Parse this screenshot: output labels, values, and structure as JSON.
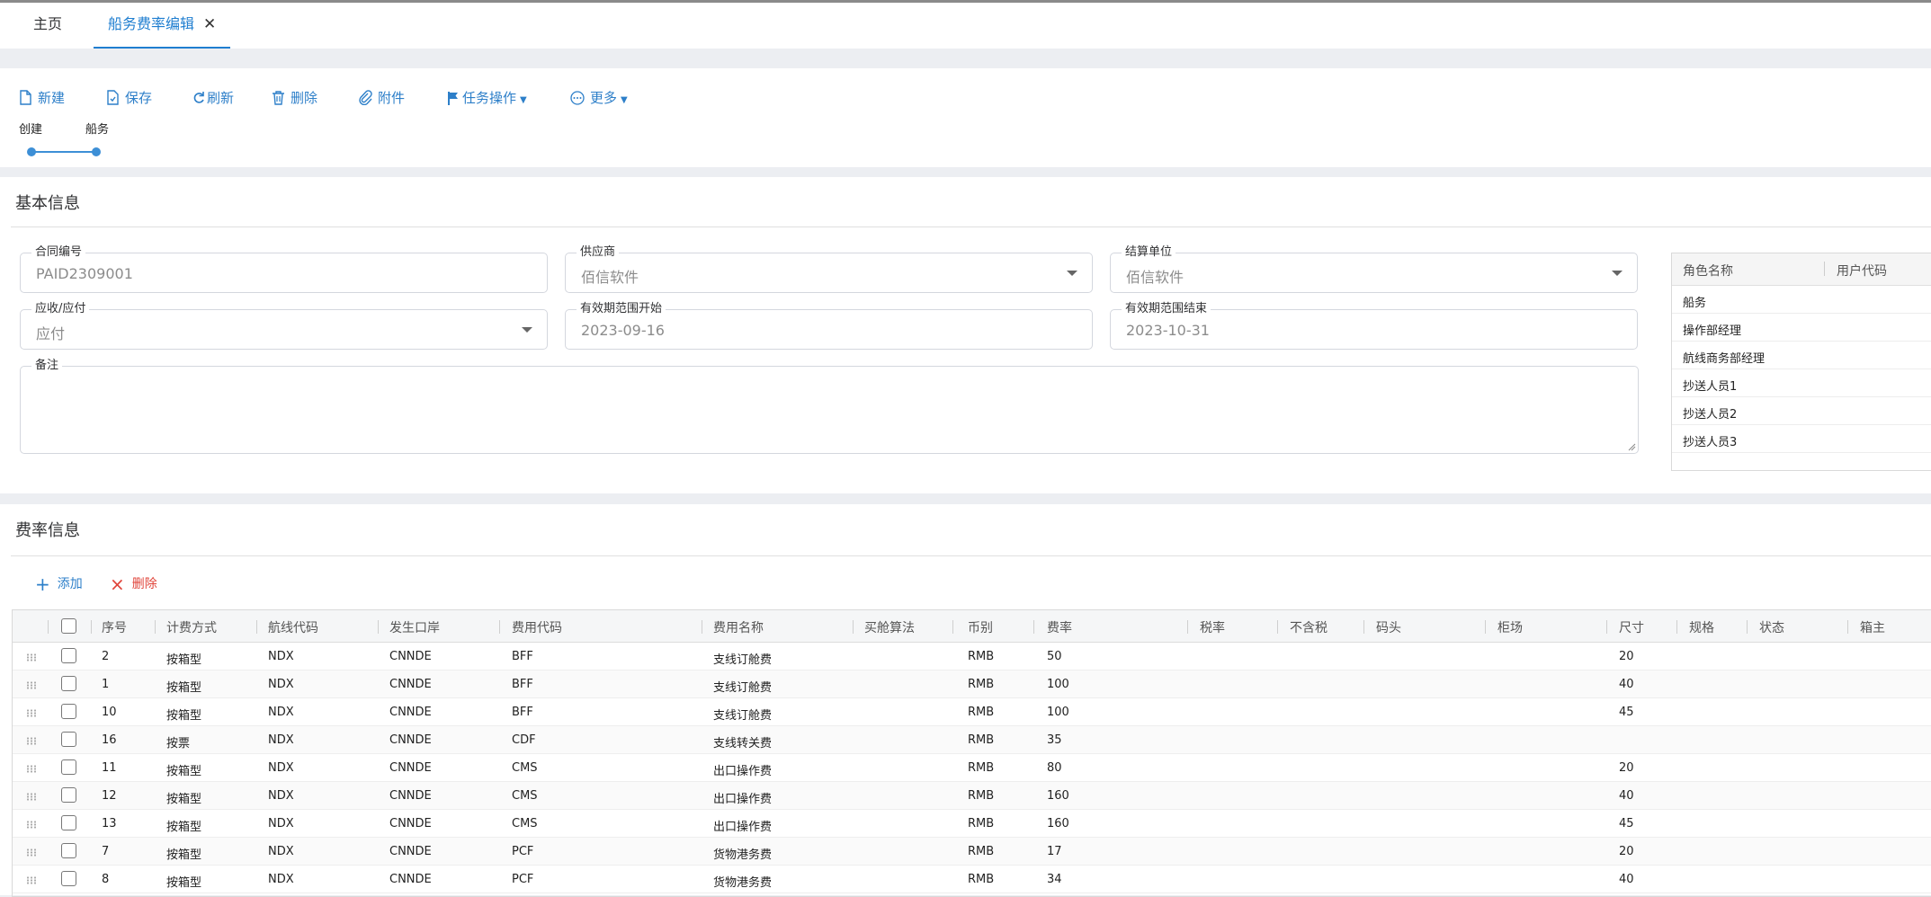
{
  "tabs": [
    {
      "label": "主页"
    },
    {
      "label": "船务费率编辑",
      "close": "✕"
    }
  ],
  "toolbar": {
    "new": "新建",
    "save": "保存",
    "refresh": "刷新",
    "delete": "删除",
    "attach": "附件",
    "task": "任务操作",
    "more": "更多"
  },
  "steps": [
    "创建",
    "船务"
  ],
  "base": {
    "title": "基本信息",
    "contract_no": {
      "label": "合同编号",
      "value": "PAID2309001"
    },
    "supplier": {
      "label": "供应商",
      "value": "佰信软件"
    },
    "settlement": {
      "label": "结算单位",
      "value": "佰信软件"
    },
    "recv_pay": {
      "label": "应收/应付",
      "value": "应付"
    },
    "valid_start": {
      "label": "有效期范围开始",
      "value": "2023-09-16"
    },
    "valid_end": {
      "label": "有效期范围结束",
      "value": "2023-10-31"
    },
    "remark": {
      "label": "备注",
      "value": ""
    }
  },
  "role_grid": {
    "headers": [
      "角色名称",
      "用户代码"
    ],
    "rows": [
      "船务",
      "操作部经理",
      "航线商务部经理",
      "抄送人员1",
      "抄送人员2",
      "抄送人员3"
    ]
  },
  "fee": {
    "title": "费率信息",
    "add": "添加",
    "delete": "删除",
    "headers": [
      "序号",
      "计费方式",
      "航线代码",
      "发生口岸",
      "费用代码",
      "费用名称",
      "买舱算法",
      "币别",
      "费率",
      "税率",
      "不含税",
      "码头",
      "柜场",
      "尺寸",
      "规格",
      "状态",
      "箱主"
    ],
    "rows": [
      [
        "2",
        "按箱型",
        "NDX",
        "CNNDE",
        "BFF",
        "支线订舱费",
        "",
        "RMB",
        "50",
        "",
        "",
        "",
        "",
        "20",
        "",
        "",
        ""
      ],
      [
        "1",
        "按箱型",
        "NDX",
        "CNNDE",
        "BFF",
        "支线订舱费",
        "",
        "RMB",
        "100",
        "",
        "",
        "",
        "",
        "40",
        "",
        "",
        ""
      ],
      [
        "10",
        "按箱型",
        "NDX",
        "CNNDE",
        "BFF",
        "支线订舱费",
        "",
        "RMB",
        "100",
        "",
        "",
        "",
        "",
        "45",
        "",
        "",
        ""
      ],
      [
        "16",
        "按票",
        "NDX",
        "CNNDE",
        "CDF",
        "支线转关费",
        "",
        "RMB",
        "35",
        "",
        "",
        "",
        "",
        "",
        "",
        "",
        ""
      ],
      [
        "11",
        "按箱型",
        "NDX",
        "CNNDE",
        "CMS",
        "出口操作费",
        "",
        "RMB",
        "80",
        "",
        "",
        "",
        "",
        "20",
        "",
        "",
        ""
      ],
      [
        "12",
        "按箱型",
        "NDX",
        "CNNDE",
        "CMS",
        "出口操作费",
        "",
        "RMB",
        "160",
        "",
        "",
        "",
        "",
        "40",
        "",
        "",
        ""
      ],
      [
        "13",
        "按箱型",
        "NDX",
        "CNNDE",
        "CMS",
        "出口操作费",
        "",
        "RMB",
        "160",
        "",
        "",
        "",
        "",
        "45",
        "",
        "",
        ""
      ],
      [
        "7",
        "按箱型",
        "NDX",
        "CNNDE",
        "PCF",
        "货物港务费",
        "",
        "RMB",
        "17",
        "",
        "",
        "",
        "",
        "20",
        "",
        "",
        ""
      ],
      [
        "8",
        "按箱型",
        "NDX",
        "CNNDE",
        "PCF",
        "货物港务费",
        "",
        "RMB",
        "34",
        "",
        "",
        "",
        "",
        "40",
        "",
        "",
        ""
      ]
    ]
  }
}
